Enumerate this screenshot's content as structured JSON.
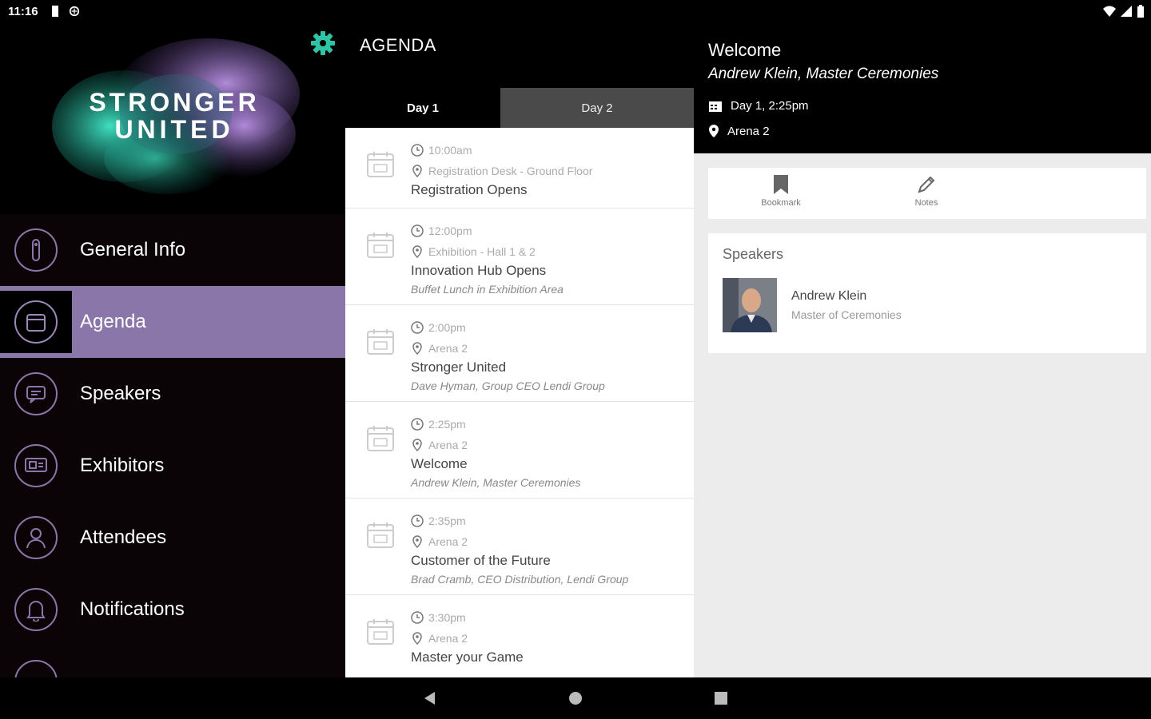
{
  "status": {
    "time": "11:16"
  },
  "brand": {
    "line1": "STRONGER",
    "line2": "UNITED",
    "accent_green": "#2ec4a6",
    "accent_purple": "#8a76a8"
  },
  "sidebar": {
    "items": [
      {
        "label": "General Info",
        "icon": "info-icon"
      },
      {
        "label": "Agenda",
        "icon": "calendar-icon",
        "active": true
      },
      {
        "label": "Speakers",
        "icon": "speech-icon"
      },
      {
        "label": "Exhibitors",
        "icon": "exhibitor-icon"
      },
      {
        "label": "Attendees",
        "icon": "person-icon"
      },
      {
        "label": "Notifications",
        "icon": "bell-icon"
      }
    ]
  },
  "agenda": {
    "title": "AGENDA",
    "tabs": [
      {
        "label": "Day 1"
      },
      {
        "label": "Day 2"
      }
    ],
    "sessions": [
      {
        "time": "10:00am",
        "location": "Registration Desk - Ground Floor",
        "title": "Registration Opens",
        "subtitle": ""
      },
      {
        "time": "12:00pm",
        "location": "Exhibition - Hall 1 & 2",
        "title": "Innovation Hub Opens",
        "subtitle": "Buffet Lunch in Exhibition Area"
      },
      {
        "time": "2:00pm",
        "location": "Arena 2",
        "title": "Stronger United",
        "subtitle": "Dave Hyman, Group CEO Lendi Group"
      },
      {
        "time": "2:25pm",
        "location": "Arena 2",
        "title": "Welcome",
        "subtitle": "Andrew Klein, Master Ceremonies"
      },
      {
        "time": "2:35pm",
        "location": "Arena 2",
        "title": "Customer of the Future",
        "subtitle": "Brad Cramb, CEO Distribution, Lendi Group"
      },
      {
        "time": "3:30pm",
        "location": "Arena 2",
        "title": "Master your Game",
        "subtitle": ""
      }
    ]
  },
  "detail": {
    "title": "Welcome",
    "subtitle": "Andrew Klein, Master Ceremonies",
    "when": "Day 1, 2:25pm",
    "where": "Arena 2",
    "actions": {
      "bookmark": "Bookmark",
      "notes": "Notes"
    },
    "speakers_heading": "Speakers",
    "speaker": {
      "name": "Andrew Klein",
      "role": "Master of Ceremonies"
    }
  }
}
